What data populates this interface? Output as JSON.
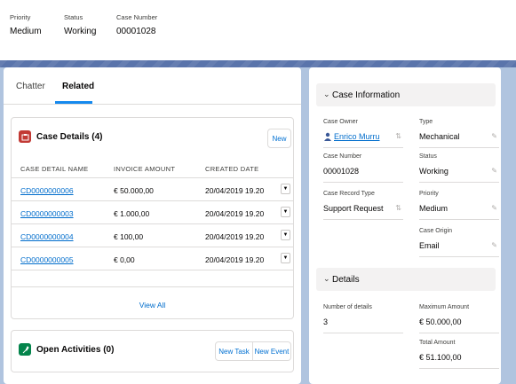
{
  "highlights": [
    {
      "label": "Priority",
      "value": "Medium"
    },
    {
      "label": "Status",
      "value": "Working"
    },
    {
      "label": "Case Number",
      "value": "00001028"
    }
  ],
  "tabs": [
    {
      "label": "Chatter"
    },
    {
      "label": "Related"
    }
  ],
  "case_details": {
    "title": "Case Details (4)",
    "new_label": "New",
    "columns": [
      "CASE DETAIL NAME",
      "INVOICE AMOUNT",
      "CREATED DATE"
    ],
    "rows": [
      {
        "name": "CD0000000006",
        "amount": "€ 50.000,00",
        "date": "20/04/2019 19.20",
        "menu": "▼"
      },
      {
        "name": "CD0000000003",
        "amount": "€ 1.000,00",
        "date": "20/04/2019 19.20",
        "menu": "▼"
      },
      {
        "name": "CD0000000004",
        "amount": "€ 100,00",
        "date": "20/04/2019 19.20",
        "menu": "▼"
      },
      {
        "name": "CD0000000005",
        "amount": "€ 0,00",
        "date": "20/04/2019 19.20",
        "menu": "▼"
      }
    ],
    "view_all": "View All",
    "icon_color": "#c23934"
  },
  "open_activities": {
    "title": "Open Activities (0)",
    "new_task": "New Task",
    "new_event": "New Event",
    "icon_color": "#04844b"
  },
  "case_information": {
    "title": "Case Information",
    "fields": [
      {
        "label": "Case Owner",
        "value": "Enrico Murru"
      },
      {
        "label": "Type",
        "value": "Mechanical"
      },
      {
        "label": "Case Number",
        "value": "00001028"
      },
      {
        "label": "Status",
        "value": "Working"
      },
      {
        "label": "Case Record Type",
        "value": "Support Request"
      },
      {
        "label": "Priority",
        "value": "Medium"
      },
      {
        "label": "Case Origin",
        "value": "Email"
      }
    ]
  },
  "details": {
    "title": "Details",
    "fields": [
      {
        "label": "Number of details",
        "value": "3"
      },
      {
        "label": "Maximum Amount",
        "value": "€ 50.000,00"
      },
      {
        "label": "Total Amount",
        "value": "€ 51.100,00"
      }
    ]
  },
  "colors": {
    "band": "#5a74ab",
    "link": "#006dcc",
    "active_tab": "#1589ee"
  }
}
